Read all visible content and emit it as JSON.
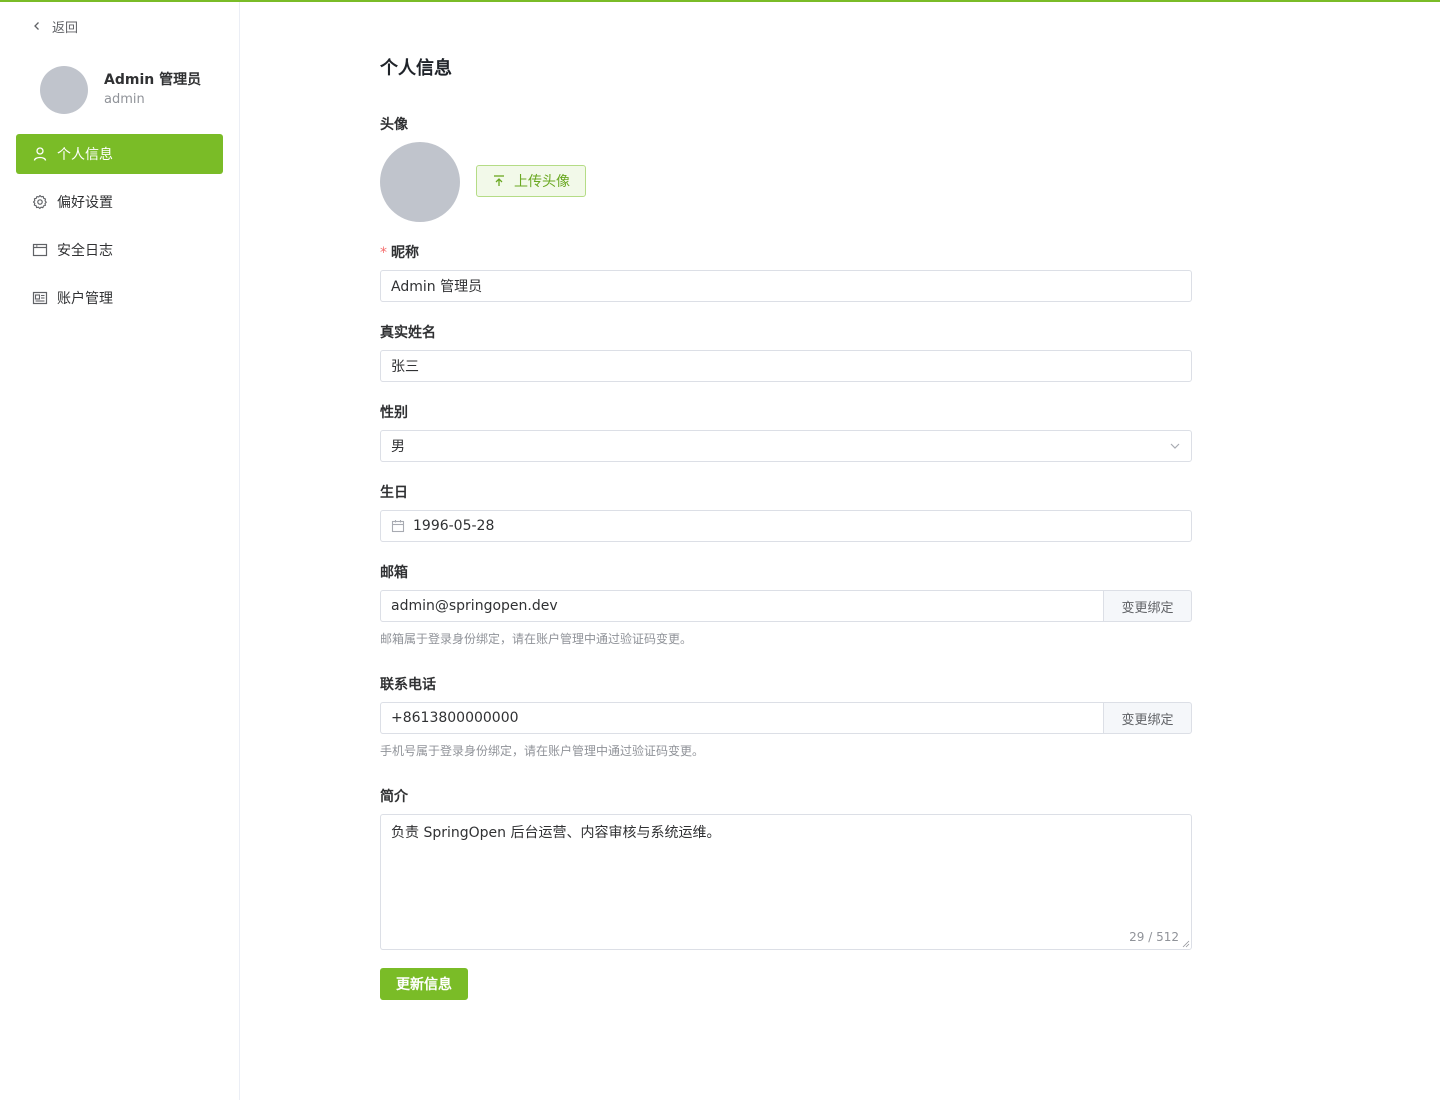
{
  "theme": {
    "accent": "#7abc27",
    "avatar_placeholder": "#c0c4cc"
  },
  "sidebar": {
    "back_label": "返回",
    "user": {
      "display_name": "Admin 管理员",
      "username": "admin"
    },
    "items": [
      {
        "label": "个人信息",
        "icon": "user-icon",
        "active": true
      },
      {
        "label": "偏好设置",
        "icon": "gear-icon",
        "active": false
      },
      {
        "label": "安全日志",
        "icon": "browser-window-icon",
        "active": false
      },
      {
        "label": "账户管理",
        "icon": "id-card-icon",
        "active": false
      }
    ]
  },
  "main": {
    "title": "个人信息",
    "avatar": {
      "label": "头像",
      "upload_label": "上传头像"
    },
    "nickname": {
      "label": "昵称",
      "required": true,
      "value": "Admin 管理员"
    },
    "real_name": {
      "label": "真实姓名",
      "value": "张三"
    },
    "gender": {
      "label": "性别",
      "value": "男"
    },
    "birthday": {
      "label": "生日",
      "value": "1996-05-28"
    },
    "email": {
      "label": "邮箱",
      "value": "admin@springopen.dev",
      "action": "变更绑定",
      "hint": "邮箱属于登录身份绑定，请在账户管理中通过验证码变更。"
    },
    "phone": {
      "label": "联系电话",
      "value": "+8613800000000",
      "action": "变更绑定",
      "hint": "手机号属于登录身份绑定，请在账户管理中通过验证码变更。"
    },
    "bio": {
      "label": "简介",
      "value": "负责 SpringOpen 后台运营、内容审核与系统运维。",
      "counter": "29 / 512"
    },
    "submit_label": "更新信息"
  }
}
